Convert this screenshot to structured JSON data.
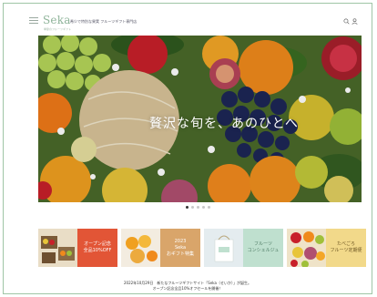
{
  "header": {
    "logo": "Seka",
    "logo_sub": "季節のフルーツギフト",
    "tagline": "希少で特別な果実 フルーツギフト専門店",
    "icons": [
      "menu-icon",
      "search-icon",
      "user-icon"
    ]
  },
  "hero": {
    "copy": "贅沢な旬を、あのひとへ",
    "slides": 5,
    "active_slide": 1
  },
  "cards": [
    {
      "lines": [
        "オープン記念",
        "全品10%OFF"
      ],
      "bg": "#e25536",
      "color": "#ffffff"
    },
    {
      "lines": [
        "2023",
        "Seka",
        "おギフト特集"
      ],
      "bg": "#d9a56a",
      "color": "#ffffff"
    },
    {
      "lines": [
        "フルーツ",
        "コンシェルジュ"
      ],
      "bg": "#bfe0cf",
      "color": "#4d7a63"
    },
    {
      "lines": [
        "たべごろ",
        "フルーツ定期便"
      ],
      "bg": "#f2d98a",
      "color": "#6b5421"
    }
  ],
  "news": {
    "line1": "2022年10月29日　新たなフルーツギフトサイト「Seka（せいか）」が誕生。",
    "line2": "オープン記念全品10%オフセールを開催！"
  },
  "colors": {
    "brand": "#8fb49a",
    "border": "#9fc6a6"
  }
}
